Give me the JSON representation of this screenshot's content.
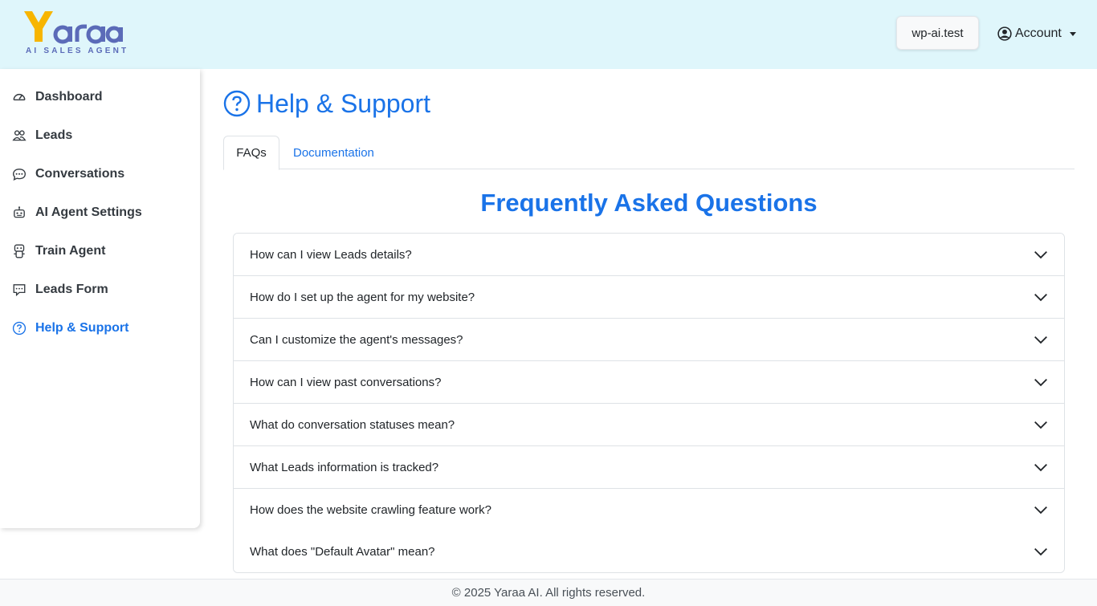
{
  "header": {
    "logo_text": "Yaraa",
    "logo_tagline": "AI SALES AGENT",
    "site_label": "wp-ai.test",
    "account_label": "Account"
  },
  "sidebar": {
    "items": [
      {
        "label": "Dashboard",
        "icon": "speedometer-icon"
      },
      {
        "label": "Leads",
        "icon": "people-icon"
      },
      {
        "label": "Conversations",
        "icon": "chat-dots-icon"
      },
      {
        "label": "AI Agent Settings",
        "icon": "robot-icon"
      },
      {
        "label": "Train Agent",
        "icon": "train-agent-icon"
      },
      {
        "label": "Leads Form",
        "icon": "form-chat-icon"
      },
      {
        "label": "Help & Support",
        "icon": "question-circle-icon",
        "active": true
      }
    ]
  },
  "main": {
    "title": "Help & Support",
    "tabs": [
      {
        "label": "FAQs",
        "active": true
      },
      {
        "label": "Documentation"
      }
    ],
    "faq_heading": "Frequently Asked Questions",
    "faqs": [
      "How can I view Leads details?",
      "How do I set up the agent for my website?",
      "Can I customize the agent's messages?",
      "How can I view past conversations?",
      "What do conversation statuses mean?",
      "What Leads information is tracked?",
      "How does the website crawling feature work?",
      "What does \"Default Avatar\" mean?"
    ]
  },
  "footer": {
    "text": "© 2025 Yaraa AI. All rights reserved."
  },
  "colors": {
    "accent": "#1a73e8",
    "header_bg": "#dff6fb",
    "logo_yellow": "#f7b500",
    "logo_purple": "#5b6bb8"
  }
}
